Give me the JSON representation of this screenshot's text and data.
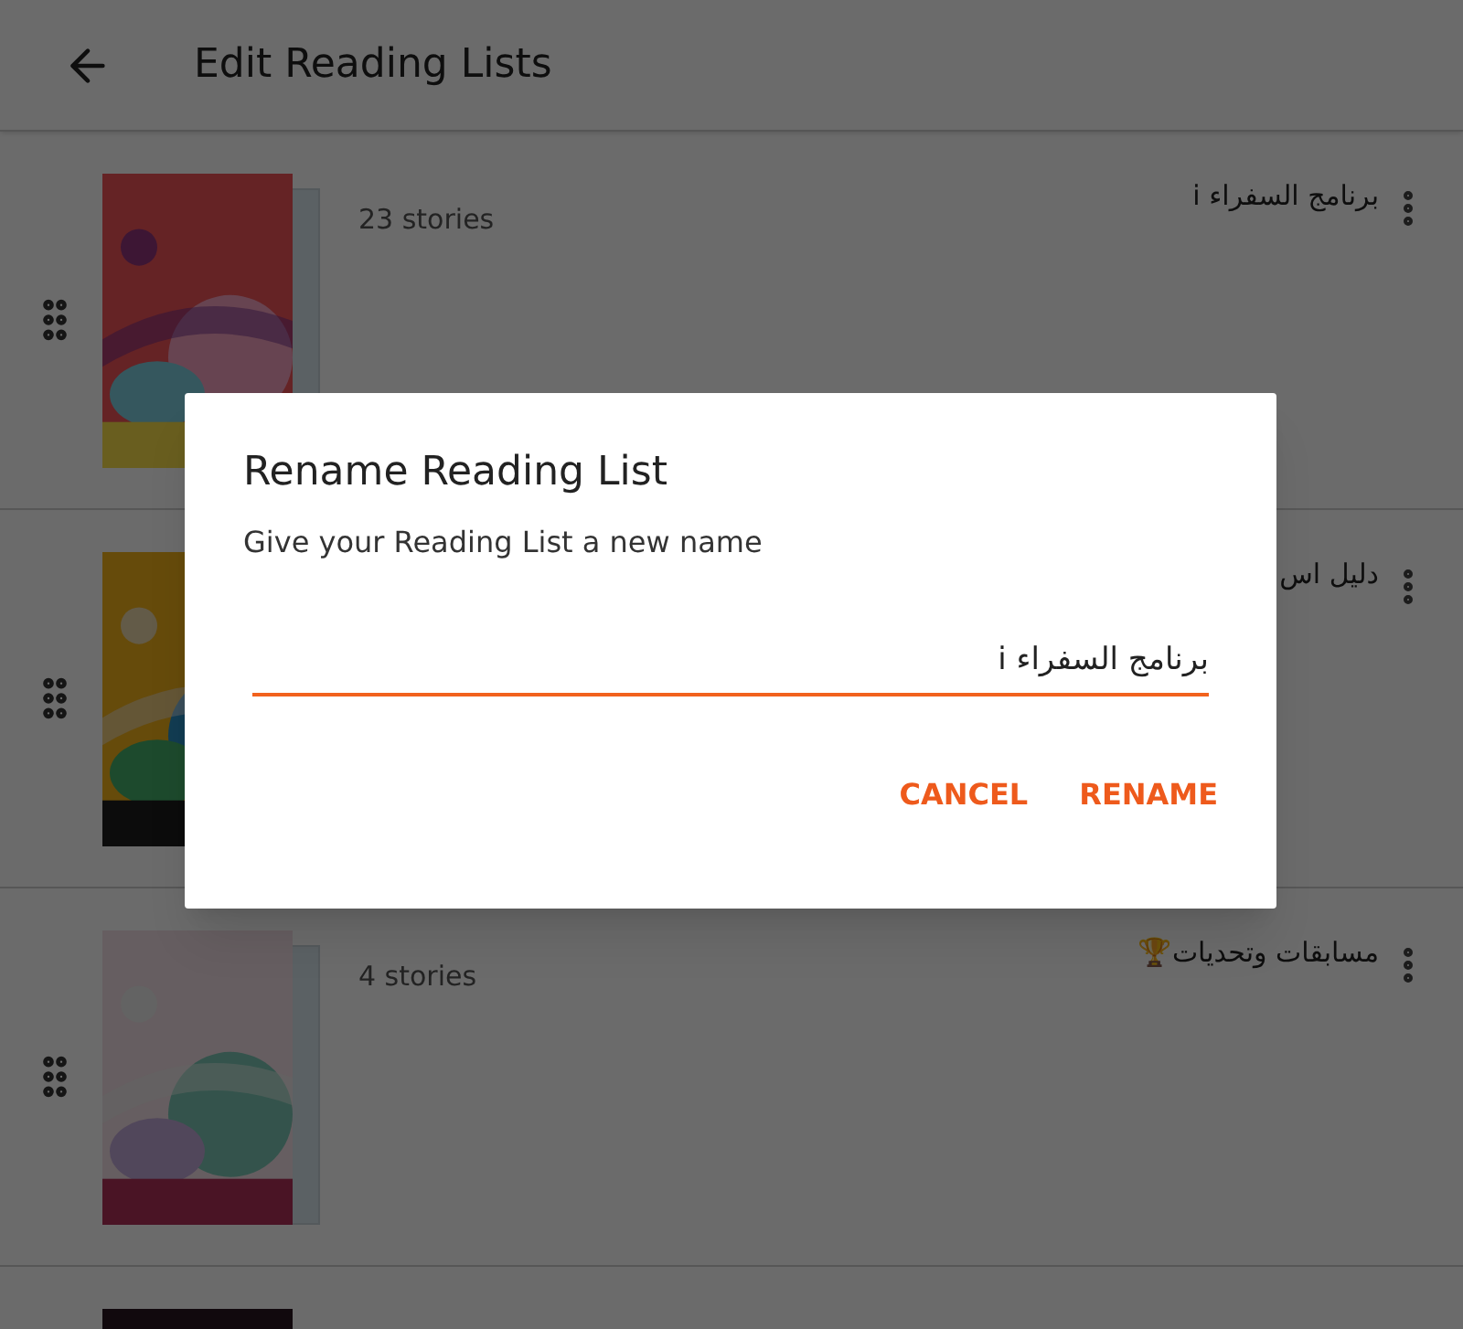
{
  "header": {
    "title": "Edit Reading Lists"
  },
  "lists": [
    {
      "title": "برنامج السفراء i",
      "count": "23 stories",
      "cover": {
        "kind": "picture"
      }
    },
    {
      "title": "دليل اس",
      "cover": {
        "kind": "picture"
      }
    },
    {
      "title": "مسابقات وتحديات🏆",
      "count": "4 stories",
      "cover": {
        "kind": "picture"
      }
    },
    {
      "cover": {
        "kind": "picture"
      }
    }
  ],
  "dialog": {
    "title": "Rename Reading List",
    "message": "Give your Reading List a new name",
    "value": "برنامج السفراء i",
    "cancel_button": "CANCEL",
    "rename_button": "RENAME"
  }
}
